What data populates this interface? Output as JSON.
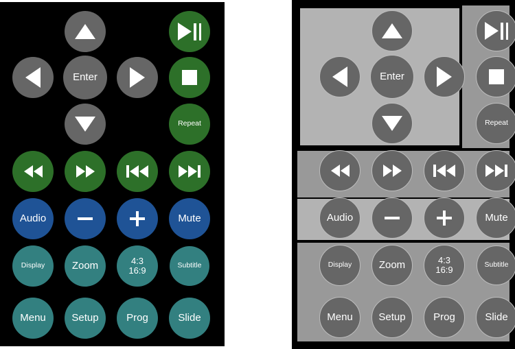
{
  "colors": {
    "background": "#000000",
    "nav_gray": "#666666",
    "transport_green": "#2d7029",
    "volume_blue": "#1f5396",
    "function_teal": "#338080",
    "group_light_gray": "#b3b3b3",
    "group_dark_gray": "#999999",
    "glyph_white": "#ffffff"
  },
  "left_panel": {
    "name": "color-remote-control",
    "buttons": [
      {
        "name": "up-button",
        "label": "",
        "icon": "triangle-up-icon",
        "color": "gray"
      },
      {
        "name": "play-pause-button",
        "label": "",
        "icon": "play-pause-icon",
        "color": "green"
      },
      {
        "name": "left-button",
        "label": "",
        "icon": "triangle-left-icon",
        "color": "gray"
      },
      {
        "name": "enter-button",
        "label": "Enter",
        "icon": "",
        "color": "gray"
      },
      {
        "name": "right-button",
        "label": "",
        "icon": "triangle-right-icon",
        "color": "gray"
      },
      {
        "name": "stop-button",
        "label": "",
        "icon": "stop-square-icon",
        "color": "green"
      },
      {
        "name": "down-button",
        "label": "",
        "icon": "triangle-down-icon",
        "color": "gray"
      },
      {
        "name": "repeat-button",
        "label": "Repeat",
        "icon": "",
        "color": "green"
      },
      {
        "name": "rewind-button",
        "label": "",
        "icon": "rewind-icon",
        "color": "green"
      },
      {
        "name": "fast-forward-button",
        "label": "",
        "icon": "fast-forward-icon",
        "color": "green"
      },
      {
        "name": "previous-track-button",
        "label": "",
        "icon": "skip-previous-icon",
        "color": "green"
      },
      {
        "name": "next-track-button",
        "label": "",
        "icon": "skip-next-icon",
        "color": "green"
      },
      {
        "name": "audio-button",
        "label": "Audio",
        "icon": "",
        "color": "blue"
      },
      {
        "name": "volume-down-button",
        "label": "",
        "icon": "minus-icon",
        "color": "blue"
      },
      {
        "name": "volume-up-button",
        "label": "",
        "icon": "plus-icon",
        "color": "blue"
      },
      {
        "name": "mute-button",
        "label": "Mute",
        "icon": "",
        "color": "blue"
      },
      {
        "name": "display-button",
        "label": "Display",
        "icon": "",
        "color": "teal"
      },
      {
        "name": "zoom-button",
        "label": "Zoom",
        "icon": "",
        "color": "teal"
      },
      {
        "name": "aspect-ratio-button",
        "label": "4:3\n16:9",
        "icon": "",
        "color": "teal"
      },
      {
        "name": "subtitle-button",
        "label": "Subtitle",
        "icon": "",
        "color": "teal"
      },
      {
        "name": "menu-button",
        "label": "Menu",
        "icon": "",
        "color": "teal"
      },
      {
        "name": "setup-button",
        "label": "Setup",
        "icon": "",
        "color": "teal"
      },
      {
        "name": "program-button",
        "label": "Prog",
        "icon": "",
        "color": "teal"
      },
      {
        "name": "slide-button",
        "label": "Slide",
        "icon": "",
        "color": "teal"
      }
    ]
  },
  "right_panel": {
    "name": "grayscale-segmentation-view",
    "groups": [
      {
        "name": "navigation-group-region",
        "fill": "#b3b3b3",
        "bordered": true
      },
      {
        "name": "playback-column-region",
        "fill": "#999999",
        "bordered": false
      },
      {
        "name": "transport-group-region",
        "fill": "#999999",
        "bordered": false
      },
      {
        "name": "volume-group-region",
        "fill": "#b3b3b3",
        "bordered": false
      },
      {
        "name": "functions-group-region",
        "fill": "#999999",
        "bordered": false
      }
    ],
    "buttons": [
      {
        "name": "up-button",
        "label": "",
        "icon": "triangle-up-icon"
      },
      {
        "name": "play-pause-button",
        "label": "",
        "icon": "play-pause-icon"
      },
      {
        "name": "left-button",
        "label": "",
        "icon": "triangle-left-icon"
      },
      {
        "name": "enter-button",
        "label": "Enter",
        "icon": ""
      },
      {
        "name": "right-button",
        "label": "",
        "icon": "triangle-right-icon"
      },
      {
        "name": "stop-button",
        "label": "",
        "icon": "stop-square-icon"
      },
      {
        "name": "down-button",
        "label": "",
        "icon": "triangle-down-icon"
      },
      {
        "name": "repeat-button",
        "label": "Repeat",
        "icon": ""
      },
      {
        "name": "rewind-button",
        "label": "",
        "icon": "rewind-icon"
      },
      {
        "name": "fast-forward-button",
        "label": "",
        "icon": "fast-forward-icon"
      },
      {
        "name": "previous-track-button",
        "label": "",
        "icon": "skip-previous-icon"
      },
      {
        "name": "next-track-button",
        "label": "",
        "icon": "skip-next-icon"
      },
      {
        "name": "audio-button",
        "label": "Audio",
        "icon": ""
      },
      {
        "name": "volume-down-button",
        "label": "",
        "icon": "minus-icon"
      },
      {
        "name": "volume-up-button",
        "label": "",
        "icon": "plus-icon"
      },
      {
        "name": "mute-button",
        "label": "Mute",
        "icon": ""
      },
      {
        "name": "display-button",
        "label": "Display",
        "icon": ""
      },
      {
        "name": "zoom-button",
        "label": "Zoom",
        "icon": ""
      },
      {
        "name": "aspect-ratio-button",
        "label": "4:3\n16:9",
        "icon": ""
      },
      {
        "name": "subtitle-button",
        "label": "Subtitle",
        "icon": ""
      },
      {
        "name": "menu-button",
        "label": "Menu",
        "icon": ""
      },
      {
        "name": "setup-button",
        "label": "Setup",
        "icon": ""
      },
      {
        "name": "program-button",
        "label": "Prog",
        "icon": ""
      },
      {
        "name": "slide-button",
        "label": "Slide",
        "icon": ""
      }
    ]
  }
}
